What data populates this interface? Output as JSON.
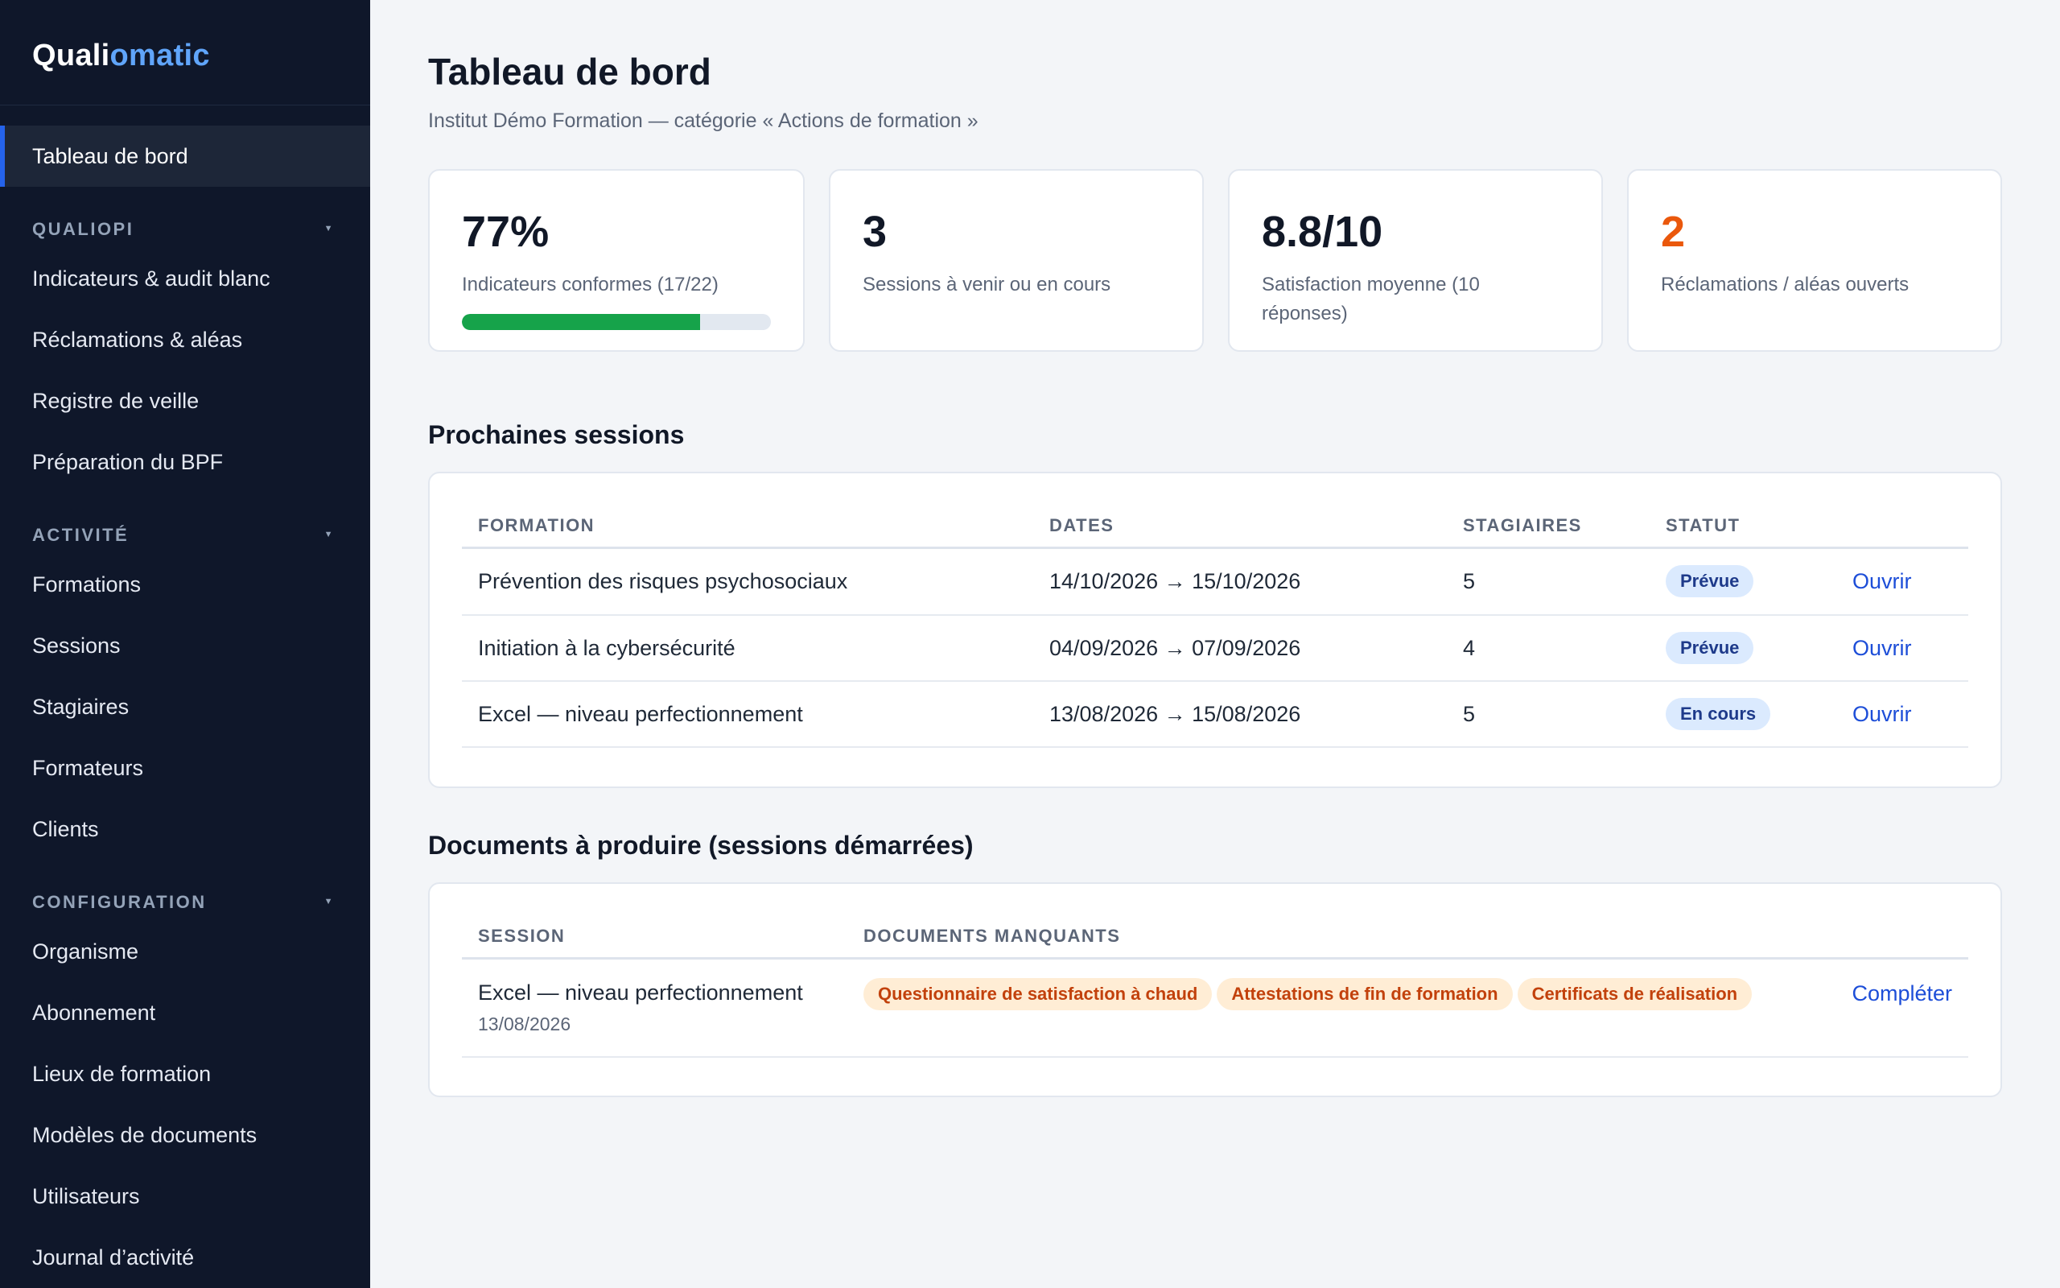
{
  "brand": {
    "part1": "Quali",
    "part2": "omatic"
  },
  "sidebar": {
    "active": "Tableau de bord",
    "sections": [
      {
        "title": "QUALIOPI",
        "items": [
          "Indicateurs & audit blanc",
          "Réclamations & aléas",
          "Registre de veille",
          "Préparation du BPF"
        ]
      },
      {
        "title": "ACTIVITÉ",
        "items": [
          "Formations",
          "Sessions",
          "Stagiaires",
          "Formateurs",
          "Clients"
        ]
      },
      {
        "title": "CONFIGURATION",
        "items": [
          "Organisme",
          "Abonnement",
          "Lieux de formation",
          "Modèles de documents",
          "Utilisateurs",
          "Journal d’activité"
        ]
      }
    ]
  },
  "header": {
    "title": "Tableau de bord",
    "subtitle": "Institut Démo Formation — catégorie « Actions de formation »"
  },
  "stats": [
    {
      "value": "77%",
      "label": "Indicateurs conformes (17/22)",
      "progress": 0.77
    },
    {
      "value": "3",
      "label": "Sessions à venir ou en cours"
    },
    {
      "value": "8.8/10",
      "label": "Satisfaction moyenne (10 réponses)"
    },
    {
      "value": "2",
      "label": "Réclamations / aléas ouverts",
      "accent": "#ea580c"
    }
  ],
  "sessions": {
    "title": "Prochaines sessions",
    "columns": [
      "FORMATION",
      "DATES",
      "STAGIAIRES",
      "STATUT"
    ],
    "rows": [
      {
        "formation": "Prévention des risques psychosociaux",
        "dates": "14/10/2026 → 15/10/2026",
        "stagiaires": "5",
        "statut": "Prévue",
        "action": "Ouvrir"
      },
      {
        "formation": "Initiation à la cybersécurité",
        "dates": "04/09/2026 → 07/09/2026",
        "stagiaires": "4",
        "statut": "Prévue",
        "action": "Ouvrir"
      },
      {
        "formation": "Excel — niveau perfectionnement",
        "dates": "13/08/2026 → 15/08/2026",
        "stagiaires": "5",
        "statut": "En cours",
        "action": "Ouvrir"
      }
    ]
  },
  "documents": {
    "title": "Documents à produire (sessions démarrées)",
    "columns": [
      "SESSION",
      "DOCUMENTS MANQUANTS"
    ],
    "rows": [
      {
        "session": "Excel — niveau perfectionnement",
        "date": "13/08/2026",
        "missing": [
          "Questionnaire de satisfaction à chaud",
          "Attestations de fin de formation",
          "Certificats de réalisation"
        ],
        "action": "Compléter"
      }
    ]
  },
  "colors": {
    "sidebar_bg": "#0f172a",
    "accent": "#2563eb",
    "progress": "#16a34a",
    "warning": "#ea580c",
    "page_bg": "#f3f5f8"
  }
}
